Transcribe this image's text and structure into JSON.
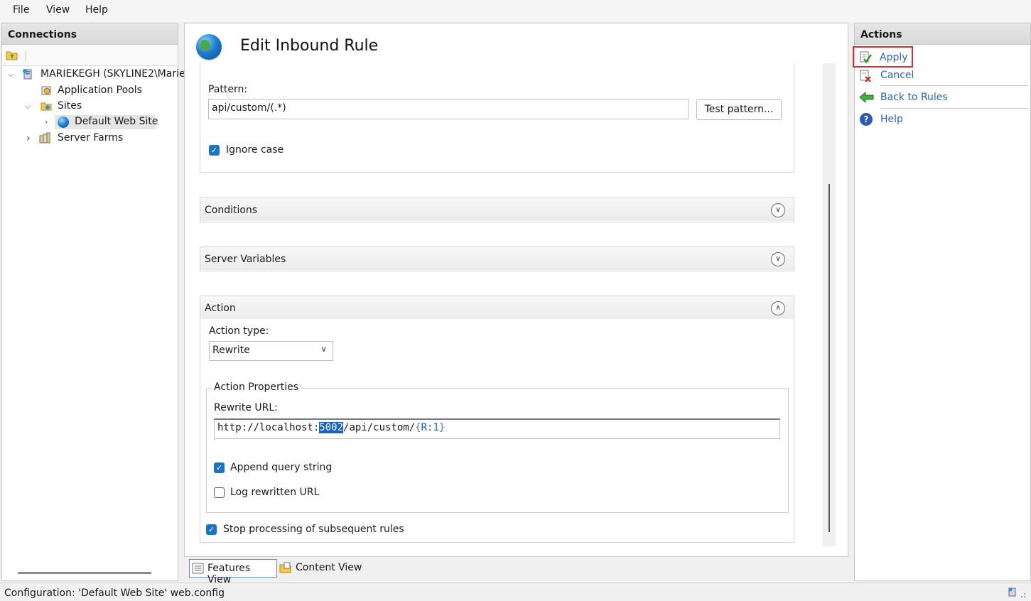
{
  "menu": {
    "file": "File",
    "view": "View",
    "help": "Help"
  },
  "connections": {
    "title": "Connections",
    "tree": {
      "server": "MARIEKEGH (SKYLINE2\\Marie",
      "app_pools": "Application Pools",
      "sites": "Sites",
      "default_site": "Default Web Site",
      "server_farms": "Server Farms"
    }
  },
  "main": {
    "title": "Edit Inbound Rule",
    "match": {
      "pattern_label": "Pattern:",
      "pattern_value": "api/custom/(.*)",
      "test_button": "Test pattern...",
      "ignore_case_label": "Ignore case",
      "ignore_case_checked": true
    },
    "conditions_label": "Conditions",
    "server_variables_label": "Server Variables",
    "action": {
      "header": "Action",
      "action_type_label": "Action type:",
      "action_type_value": "Rewrite",
      "properties_legend": "Action Properties",
      "rewrite_url_label": "Rewrite URL:",
      "rewrite_url_prefix": "http://localhost:",
      "rewrite_url_selected": "5002",
      "rewrite_url_path": "/api/custom/",
      "rewrite_url_brace_open": "{",
      "rewrite_url_var": "R:1",
      "rewrite_url_brace_close": "}",
      "append_query_label": "Append query string",
      "append_query_checked": true,
      "log_rewritten_label": "Log rewritten URL",
      "log_rewritten_checked": false,
      "stop_processing_label": "Stop processing of subsequent rules",
      "stop_processing_checked": true
    },
    "view_tabs": {
      "features": "Features View",
      "content": "Content View"
    }
  },
  "actions": {
    "title": "Actions",
    "apply": "Apply",
    "cancel": "Cancel",
    "back": "Back to Rules",
    "help": "Help"
  },
  "status": {
    "text": "Configuration: 'Default Web Site' web.config"
  },
  "colors": {
    "accent": "#1a73c8",
    "link": "#2b63b6",
    "highlight": "#d83030",
    "selection": "#1560c9"
  }
}
